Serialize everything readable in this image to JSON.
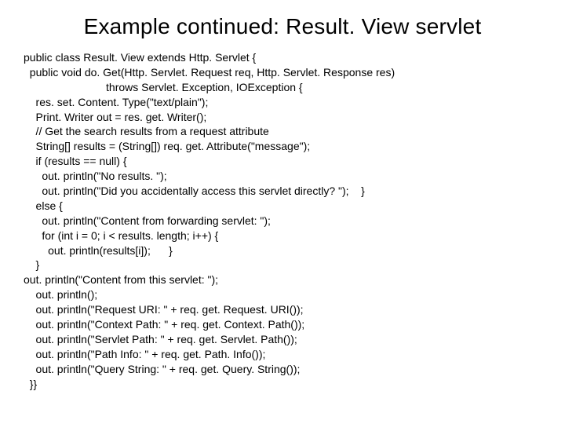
{
  "title": "Example continued: Result. View servlet",
  "code_lines": [
    "public class Result. View extends Http. Servlet {",
    "  public void do. Get(Http. Servlet. Request req, Http. Servlet. Response res)",
    "                           throws Servlet. Exception, IOException {",
    "    res. set. Content. Type(\"text/plain\");",
    "    Print. Writer out = res. get. Writer();",
    "    // Get the search results from a request attribute",
    "    String[] results = (String[]) req. get. Attribute(\"message\");",
    "    if (results == null) {",
    "      out. println(\"No results. \");",
    "      out. println(\"Did you accidentally access this servlet directly? \");    }",
    "    else {",
    "      out. println(\"Content from forwarding servlet: \");",
    "      for (int i = 0; i < results. length; i++) {",
    "        out. println(results[i]);      }",
    "    }",
    "out. println(\"Content from this servlet: \");",
    "    out. println();",
    "    out. println(\"Request URI: \" + req. get. Request. URI());",
    "    out. println(\"Context Path: \" + req. get. Context. Path());",
    "    out. println(\"Servlet Path: \" + req. get. Servlet. Path());",
    "    out. println(\"Path Info: \" + req. get. Path. Info());",
    "    out. println(\"Query String: \" + req. get. Query. String());",
    "  }}"
  ]
}
